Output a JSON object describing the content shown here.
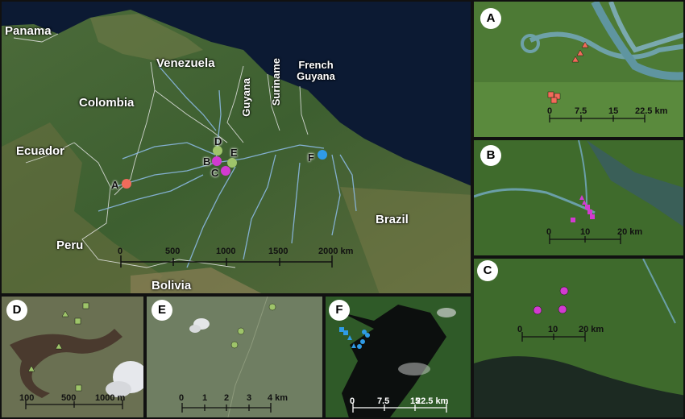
{
  "main_map": {
    "countries": [
      "Panama",
      "Venezuela",
      "Colombia",
      "Guyana",
      "Suriname",
      "French Guyana",
      "Ecuador",
      "Peru",
      "Brazil",
      "Bolivia"
    ],
    "sites": [
      "A",
      "B",
      "C",
      "D",
      "E",
      "F"
    ],
    "site_colors": {
      "A": "#f26b5b",
      "B": "#d23bd0",
      "C": "#d23bd0",
      "D": "#9ec46a",
      "E": "#9ec46a",
      "F": "#2f9be6"
    },
    "scale_ticks": [
      "0",
      "500",
      "1000",
      "1500",
      "2000 km"
    ]
  },
  "panels": {
    "A": {
      "letter": "A",
      "scale_ticks": [
        "0",
        "7.5",
        "15",
        "22.5 km"
      ]
    },
    "B": {
      "letter": "B",
      "scale_ticks": [
        "0",
        "10",
        "20 km"
      ]
    },
    "C": {
      "letter": "C",
      "scale_ticks": [
        "0",
        "10",
        "20 km"
      ]
    },
    "D": {
      "letter": "D",
      "scale_ticks": [
        "100",
        "500",
        "1000 m"
      ]
    },
    "E": {
      "letter": "E",
      "scale_ticks": [
        "0",
        "1",
        "2",
        "3",
        "4 km"
      ]
    },
    "F": {
      "letter": "F",
      "scale_ticks": [
        "0",
        "7.5",
        "15",
        "22.5 km"
      ]
    }
  }
}
